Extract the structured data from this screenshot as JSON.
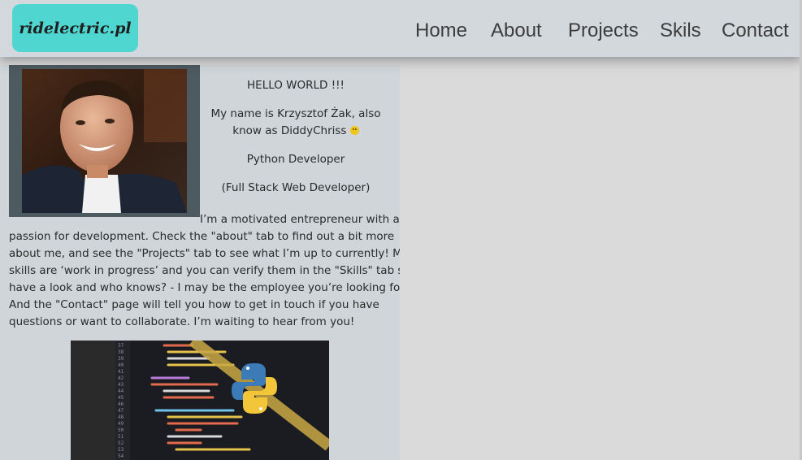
{
  "nav": {
    "logo": "ridelectric.pl",
    "links": [
      "Home",
      "About",
      "Projects",
      "Skils",
      "Contact"
    ]
  },
  "intro": {
    "greeting": "HELLO WORLD !!!",
    "name_line": "My name is Krzysztof Żak, also know as DiddyChriss",
    "role": "Python Developer",
    "subrole": "(Full Stack Web Developer)"
  },
  "bio": {
    "first_line": "I’m a motivated entrepreneur with a",
    "lines": [
      "passion for development. Check the \"about\" tab to find out a bit more",
      "about me, and see the \"Projects\" tab to see what I’m up to currently! My",
      "skills are ‘work in progress’ and you can verify them in the \"Skills\" tab so",
      "have a look and who knows? - I may be the employee you’re looking for.",
      "And the \"Contact\" page will tell you how to get in touch if you have",
      "questions or want to collaborate. I’m waiting to hear from you!"
    ]
  },
  "colors": {
    "logo_bg": "#4fd6d0",
    "navbar_bg": "#d3d8dc",
    "card_bg": "#cfd5d9",
    "page_bg": "#dadada"
  }
}
